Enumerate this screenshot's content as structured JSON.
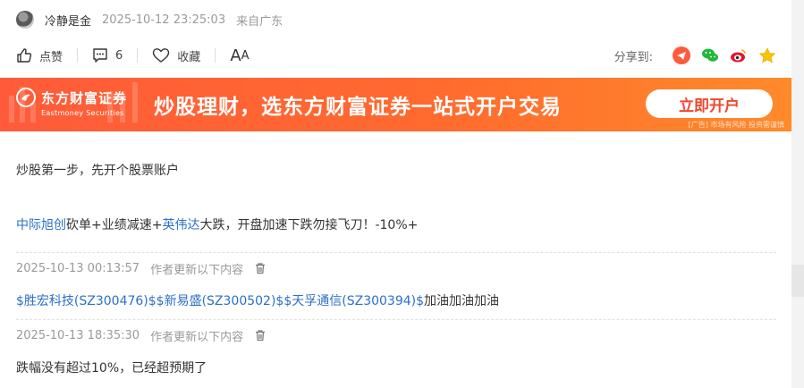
{
  "post_meta": {
    "author": "冷静是金",
    "time": "2025-10-12 23:25:03",
    "source": "来自广东"
  },
  "actions": {
    "like_label": "点赞",
    "comment_count": "6",
    "favorite_label": "收藏",
    "font_big": "A",
    "font_small": "A",
    "share_label": "分享到:"
  },
  "share_icons": [
    "telegram-style-icon",
    "wechat-icon",
    "weibo-icon",
    "qzone-star-icon"
  ],
  "banner": {
    "brand_cn": "东方财富证券",
    "brand_en": "Eastmoney Securities",
    "slogan": "炒股理财，选东方财富证券一站式开户交易",
    "button": "立即开户",
    "disclaimer": "[广告] 市场有风险 投资需谨慎"
  },
  "body": {
    "link_open_account": "炒股第一步，先开个股票账户",
    "main": {
      "link1": "中际旭创",
      "text1": "砍单+业绩减速+",
      "link2": "英伟达",
      "text2": "大跌，开盘加速下跌勿接飞刀！-10%+"
    }
  },
  "updates": [
    {
      "time": "2025-10-13 00:13:57",
      "label": "作者更新以下内容",
      "stocks": [
        "$胜宏科技(SZ300476)$",
        "$新易盛(SZ300502)$",
        "$天孚通信(SZ300394)$"
      ],
      "text": "加油加油加油"
    },
    {
      "time": "2025-10-13 18:35:30",
      "label": "作者更新以下内容",
      "text": "跌幅没有超过10%，已经超预期了"
    }
  ],
  "colors": {
    "link": "#2d6fc8",
    "banner_start": "#ff5b3a",
    "banner_end": "#ff8a2a",
    "button_text": "#f1462e"
  }
}
